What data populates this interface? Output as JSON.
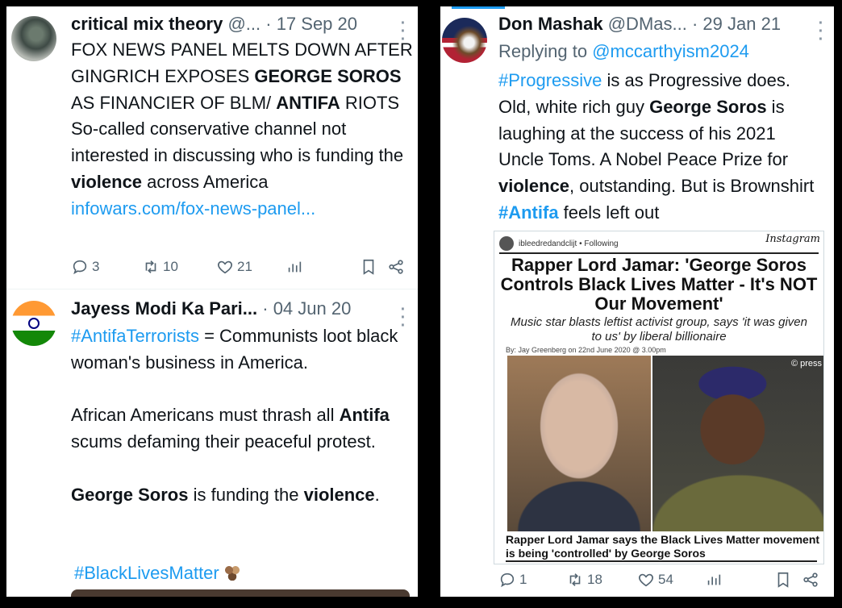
{
  "left": {
    "tweets": [
      {
        "name": "critical mix theory",
        "handle": "@...",
        "date": "17 Sep 20",
        "body": [
          {
            "t": "FOX NEWS PANEL MELTS DOWN AFTER GINGRICH EXPOSES ",
            "s": ""
          },
          {
            "t": "GEORGE SOROS",
            "s": "bold"
          },
          {
            "t": " AS FINANCIER OF BLM/ ",
            "s": ""
          },
          {
            "t": "ANTIFA",
            "s": "bold"
          },
          {
            "t": " RIOTS So-called conservative channel not interested in discussing who is funding the ",
            "s": ""
          },
          {
            "t": "violence",
            "s": "bold"
          },
          {
            "t": " across America",
            "s": ""
          }
        ],
        "link": "infowars.com/fox-news-panel...",
        "actions": {
          "replies": "3",
          "retweets": "10",
          "likes": "21"
        }
      },
      {
        "name": "Jayess Modi Ka Pari...",
        "handle": "",
        "date": "04 Jun 20",
        "hashtag": "#AntifaTerrorists",
        "line1": " = Communists loot black woman's business in America.",
        "para2_a": "African Americans must thrash all ",
        "para2_b": "Antifa",
        "para2_c": " scums defaming their peaceful protest.",
        "para3_a": "George Soros",
        "para3_b": " is funding the ",
        "para3_c": "violence",
        "para3_d": ".",
        "hashtag2": "#BlackLivesMatter"
      }
    ]
  },
  "right": {
    "name": "Don Mashak",
    "handle": "@DMas...",
    "date": "29 Jan 21",
    "replying_label": "Replying to ",
    "replying_to": "@mccarthyism2024",
    "body_a": "#Progressive",
    "body_b": " is as Progressive does. Old, white rich guy ",
    "body_c": "George Soros",
    "body_d": " is laughing at the success of his 2021 Uncle Toms. A Nobel Peace Prize for ",
    "body_e": "violence",
    "body_f": ", outstanding.  But is Brownshirt ",
    "body_g": "#Antifa",
    "body_h": " feels left out",
    "embed": {
      "account": "ibleedredandclijt",
      "following": "• Following",
      "instagram": "Instagram",
      "headline": "Rapper Lord Jamar: 'George Soros Controls Black Lives Matter - It's NOT Our Movement'",
      "subhead": "Music star blasts leftist activist group, says 'it was given to us' by liberal billionaire",
      "byline": "By: Jay Greenberg on 22nd June 2020 @ 3.00pm",
      "press": "© press",
      "caption": "Rapper Lord Jamar says the Black Lives Matter movement is being 'controlled' by George Soros"
    },
    "actions": {
      "replies": "1",
      "retweets": "18",
      "likes": "54"
    }
  },
  "colors": {
    "link": "#1d9bf0",
    "muted": "#536471"
  }
}
